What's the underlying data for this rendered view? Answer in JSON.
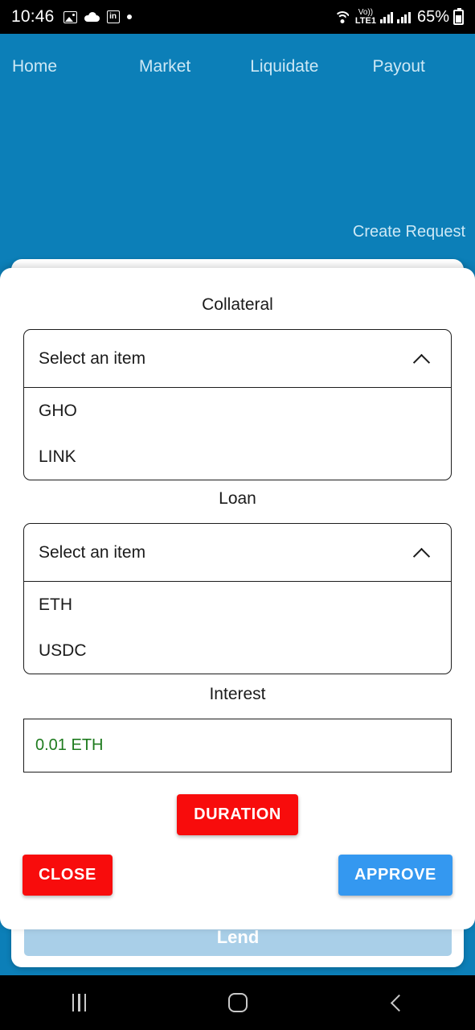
{
  "status_bar": {
    "time": "10:46",
    "left_icons": [
      "image-icon",
      "cloud-icon",
      "linkedin-icon",
      "dot-icon"
    ],
    "wifi_icon": "wifi-icon",
    "volte_top": "Vo))",
    "volte_label": "LTE1",
    "signal_icons": [
      "signal-bars-icon",
      "signal-bars-icon"
    ],
    "battery_percent": "65%",
    "battery_icon": "battery-icon"
  },
  "app_header": {
    "nav": [
      {
        "label": "Home"
      },
      {
        "label": "Market"
      },
      {
        "label": "Liquidate"
      },
      {
        "label": "Payout"
      }
    ],
    "create_request_label": "Create Request",
    "background_color": "#0C7FB8",
    "nav_text_color": "#CDE8F5"
  },
  "background_page": {
    "lend_button_label": "Lend",
    "lend_button_color": "#A9CFE8"
  },
  "modal": {
    "collateral": {
      "label": "Collateral",
      "select_value": "Select an item",
      "chevron_icon": "chevron-up-icon",
      "options": [
        {
          "label": "GHO"
        },
        {
          "label": "LINK"
        }
      ]
    },
    "loan": {
      "label": "Loan",
      "select_value": "Select an item",
      "chevron_icon": "chevron-up-icon",
      "options": [
        {
          "label": "ETH"
        },
        {
          "label": "USDC"
        }
      ]
    },
    "interest": {
      "label": "Interest",
      "value": "0.01 ETH",
      "value_color": "#1E7B1E"
    },
    "duration_button": {
      "label": "DURATION",
      "color": "#F80C0C"
    },
    "close_button": {
      "label": "CLOSE",
      "color": "#F80C0C"
    },
    "approve_button": {
      "label": "APPROVE",
      "color": "#3498F0"
    }
  },
  "system_nav": {
    "recents_icon": "recents-icon",
    "home_icon": "home-icon",
    "back_icon": "back-icon"
  }
}
